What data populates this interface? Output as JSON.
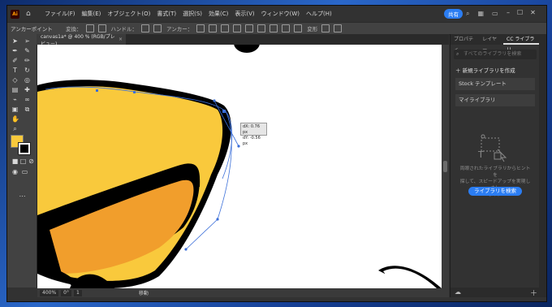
{
  "app": {
    "logo": "Ai",
    "menu": [
      "ファイル(F)",
      "編集(E)",
      "オブジェクト(O)",
      "書式(T)",
      "選択(S)",
      "効果(C)",
      "表示(V)",
      "ウィンドウ(W)",
      "ヘルプ(H)"
    ],
    "share_label": "共有"
  },
  "control_bar": {
    "mode_label": "アンカーポイント",
    "convert_label": "変換：",
    "handle_label": "ハンドル：",
    "anchor_label": "アンカー：",
    "transform_label": "変形"
  },
  "document_tab": {
    "title": "canvas1a* @ 400 % (RGB/プレビュー)",
    "close": "×"
  },
  "tooltip": {
    "dx": "dX: 0.76 px",
    "dy": "dY: -0.56 px"
  },
  "status": {
    "zoom": "400%",
    "rotation": "0°",
    "artboard": "1",
    "tool": "移動"
  },
  "panel": {
    "tabs": [
      "プロパティ",
      "レイヤー",
      "CC ライブラリ"
    ],
    "active_tab": 2,
    "search_placeholder": "すべてのライブラリを検索",
    "new_library": "新規ライブラリを作成",
    "items": [
      "Stock テンプレート",
      "マイライブラリ"
    ],
    "empty_text": "両眼されたライブラリからヒントを\n探して、スピードアップを実現しまし\nょう。",
    "cta": "ライブラリを検索"
  },
  "colors": {
    "fill": "#f9c93c",
    "stroke": "#000000",
    "accent": "#2b7df2",
    "inner": "#f19e2c"
  }
}
